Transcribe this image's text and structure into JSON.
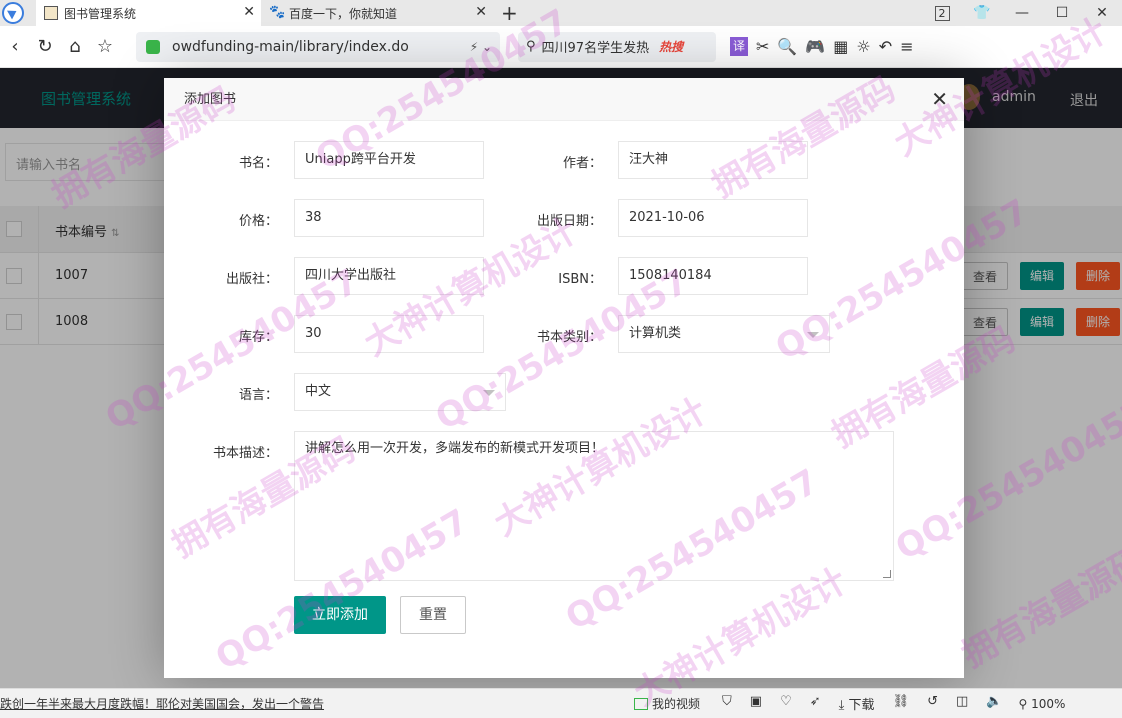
{
  "browser": {
    "tabs": [
      {
        "title": "图书管理系统",
        "active": true
      },
      {
        "title": "百度一下，你就知道",
        "active": false
      }
    ],
    "new_tab": "+",
    "tab_count": "2",
    "url": "owdfunding-main/library/index.do",
    "search_text": "四川97名学生发热",
    "search_hot": "热搜",
    "translate_label": "译"
  },
  "app": {
    "logo": "图书管理系统",
    "user": "admin",
    "logout": "退出"
  },
  "background": {
    "search_placeholder": "请输入书名",
    "table": {
      "column_header": "书本编号",
      "rows": [
        {
          "id": "1007"
        },
        {
          "id": "1008"
        }
      ],
      "actions": {
        "view": "查看",
        "edit": "编辑",
        "delete": "删除"
      }
    }
  },
  "modal": {
    "title": "添加图书",
    "fields": {
      "name": {
        "label": "书名：",
        "value": "Uniapp跨平台开发"
      },
      "author": {
        "label": "作者：",
        "value": "汪大神"
      },
      "price": {
        "label": "价格：",
        "value": "38"
      },
      "pub_date": {
        "label": "出版日期：",
        "value": "2021-10-06"
      },
      "publisher": {
        "label": "出版社：",
        "value": "四川大学出版社"
      },
      "isbn": {
        "label": "ISBN：",
        "value": "1508140184"
      },
      "stock": {
        "label": "库存：",
        "value": "30"
      },
      "category": {
        "label": "书本类别：",
        "value": "计算机类"
      },
      "language": {
        "label": "语言：",
        "value": "中文"
      },
      "description": {
        "label": "书本描述：",
        "value": "讲解怎么用一次开发，多端发布的新模式开发项目！"
      }
    },
    "submit": "立即添加",
    "reset": "重置"
  },
  "statusbar": {
    "news": "跌创一年半来最大月度跌幅！耶伦对美国国会，发出一个警告",
    "video": "我的视频",
    "download": "下载",
    "zoom": "100%"
  },
  "watermarks": [
    "QQ:254540457",
    "拥有海量源码",
    "大神计算机设计"
  ]
}
